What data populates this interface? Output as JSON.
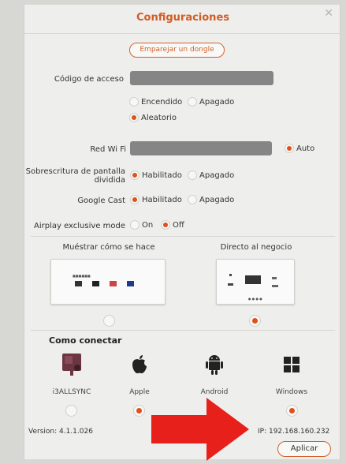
{
  "dialog": {
    "title": "Configuraciones",
    "pair_button": "Emparejar un dongle"
  },
  "settings": {
    "access_code": {
      "label": "Código de acceso",
      "options": [
        {
          "label": "Encendido",
          "selected": false
        },
        {
          "label": "Apagado",
          "selected": false
        },
        {
          "label": "Aleatorio",
          "selected": true
        }
      ]
    },
    "wifi": {
      "label": "Red Wi Fi",
      "auto_label": "Auto",
      "auto_selected": true
    },
    "split_screen": {
      "label_line1": "Sobrescritura de pantalla",
      "label_line2": "dividida",
      "options": [
        {
          "label": "Habilitado",
          "selected": true
        },
        {
          "label": "Apagado",
          "selected": false
        }
      ]
    },
    "google_cast": {
      "label": "Google Cast",
      "options": [
        {
          "label": "Habilitado",
          "selected": true
        },
        {
          "label": "Apagado",
          "selected": false
        }
      ]
    },
    "airplay": {
      "label": "Airplay exclusive mode",
      "options": [
        {
          "label": "On",
          "selected": false
        },
        {
          "label": "Off",
          "selected": true
        }
      ]
    }
  },
  "screen_modes": [
    {
      "label": "Muéstrar cómo se hace",
      "selected": false
    },
    {
      "label": "Directo al negocio",
      "selected": true
    }
  ],
  "connect": {
    "heading": "Como conectar",
    "platforms": [
      {
        "label": "i3ALLSYNC",
        "icon": "i3allsync-icon",
        "selected": false
      },
      {
        "label": "Apple",
        "icon": "apple-icon",
        "selected": true
      },
      {
        "label": "Android",
        "icon": "android-icon",
        "selected": true
      },
      {
        "label": "Windows",
        "icon": "windows-icon",
        "selected": true
      }
    ]
  },
  "footer": {
    "version": "Version: 4.1.1.026",
    "ip": "IP: 192.168.160.232",
    "apply_button": "Aplicar"
  },
  "colors": {
    "accent": "#d2622d",
    "radio_selected": "#e0501b",
    "arrow": "#e8201b"
  }
}
